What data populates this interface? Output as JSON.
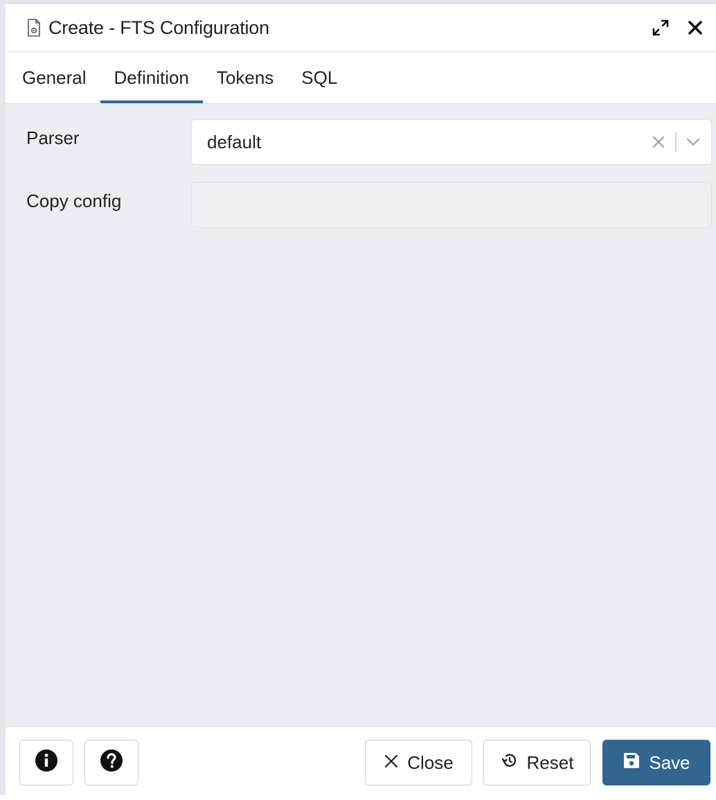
{
  "dialog": {
    "title": "Create - FTS Configuration"
  },
  "tabs": [
    {
      "label": "General",
      "active": false
    },
    {
      "label": "Definition",
      "active": true
    },
    {
      "label": "Tokens",
      "active": false
    },
    {
      "label": "SQL",
      "active": false
    }
  ],
  "form": {
    "parser": {
      "label": "Parser",
      "value": "default"
    },
    "copy_config": {
      "label": "Copy config",
      "value": ""
    }
  },
  "footer": {
    "close_label": "Close",
    "reset_label": "Reset",
    "save_label": "Save"
  },
  "icons": {
    "title": "file-config-icon",
    "expand": "expand-icon",
    "close": "close-icon",
    "clear": "clear-icon",
    "dropdown": "chevron-down-icon",
    "info": "info-icon",
    "help": "help-icon",
    "reset": "reset-icon",
    "save": "save-icon"
  },
  "colors": {
    "accent": "#326690",
    "content_bg": "#ebedf2"
  }
}
